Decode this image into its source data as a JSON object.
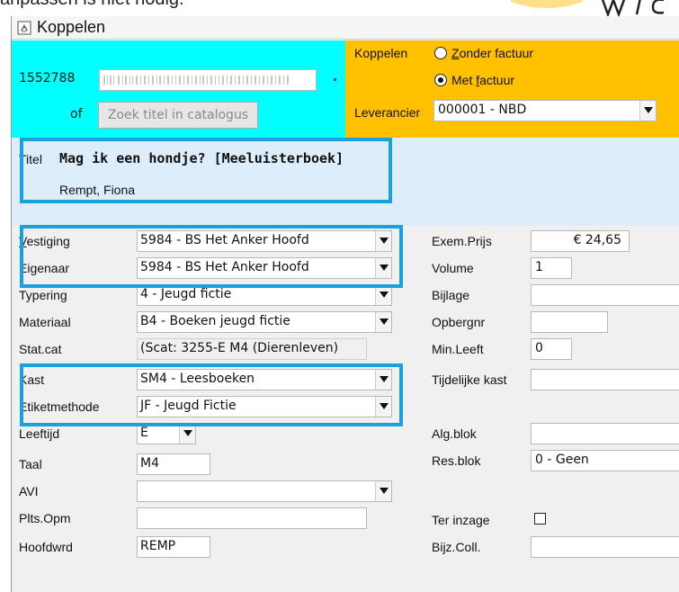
{
  "heading_crop": "anpassen is niet nodig.",
  "window": {
    "title": "Koppelen"
  },
  "top": {
    "isbn": "1552788",
    "of_label": "of",
    "search_button": "Zoek titel in catalogus",
    "koppelen_label": "Koppelen",
    "radio_zonder": "Zonder factuur",
    "radio_met": "Met factuur",
    "leverancier_label": "Leverancier",
    "leverancier_value": "000001 - NBD"
  },
  "title_block": {
    "titel_label": "Titel",
    "titel_value": "Mag ik een hondje? [Meeluisterboek]",
    "author": "Rempt, Fiona"
  },
  "left_fields": [
    {
      "label": "Vestiging",
      "value": "5984 - BS Het Anker Hoofd"
    },
    {
      "label": "Eigenaar",
      "value": "5984 - BS Het Anker Hoofd"
    },
    {
      "label": "Typering",
      "value": "4 - Jeugd fictie"
    },
    {
      "label": "Materiaal",
      "value": "B4 - Boeken jeugd fictie"
    },
    {
      "label": "Stat.cat",
      "value": "(Scat: 3255-E M4 (Dierenleven)"
    },
    {
      "label": "Kast",
      "value": "SM4 - Leesboeken"
    },
    {
      "label": "Etiketmethode",
      "value": "JF - Jeugd Fictie"
    },
    {
      "label": "Leeftijd",
      "value": "E"
    },
    {
      "label": "Taal",
      "value": "M4"
    },
    {
      "label": "AVI",
      "value": ""
    },
    {
      "label": "Plts.Opm",
      "value": ""
    },
    {
      "label": "Hoofdwrd",
      "value": "REMP"
    }
  ],
  "right_fields": [
    {
      "label": "Exem.Prijs",
      "value": "€ 24,65"
    },
    {
      "label": "Volume",
      "value": "1"
    },
    {
      "label": "Bijlage",
      "value": ""
    },
    {
      "label": "Opbergnr",
      "value": ""
    },
    {
      "label": "Min.Leeft",
      "value": "0"
    },
    {
      "label": "Tijdelijke kast",
      "value": ""
    },
    {
      "label": "Alg.blok",
      "value": ""
    },
    {
      "label": "Res.blok",
      "value": "0 - Geen"
    },
    {
      "label": "Ter inzage",
      "value": ""
    },
    {
      "label": "Bijz.Coll.",
      "value": ""
    }
  ],
  "colors": {
    "cyan": "#00ffff",
    "yellow": "#ffc000",
    "lightblue": "#ddeefa",
    "highlight": "#1aa0dc"
  }
}
